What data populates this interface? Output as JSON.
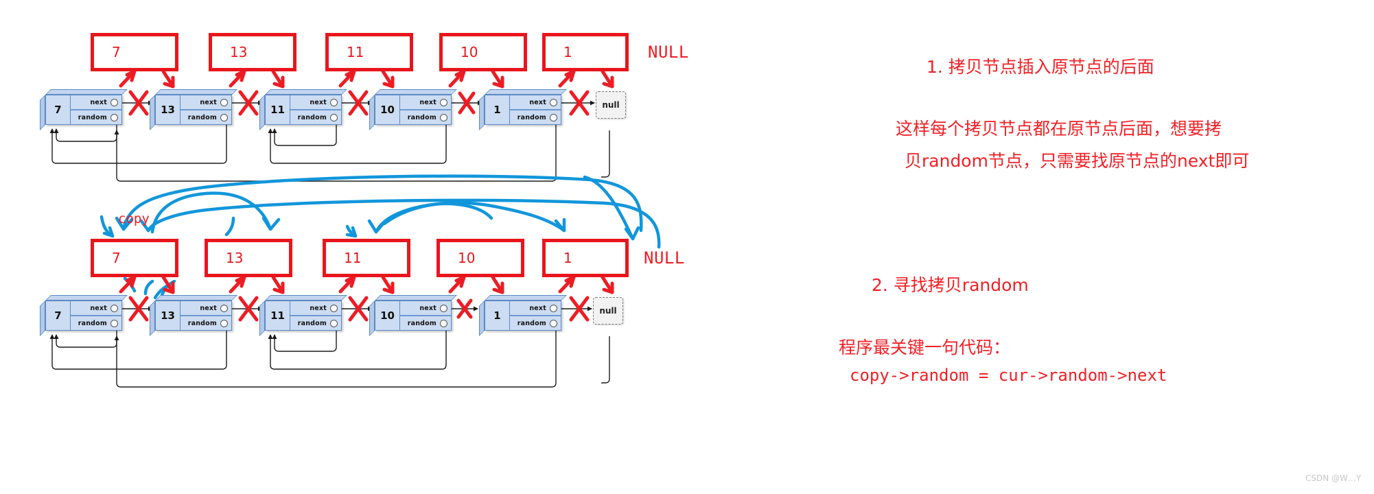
{
  "diagram": {
    "title": "Copy List with Random Pointer - interleaved copy nodes",
    "node_field_labels": {
      "next": "next",
      "random": "random"
    },
    "null_text": "null",
    "null_label": "NULL",
    "copy_label": "copy",
    "colors": {
      "red": "#f01c22",
      "box_red": "#e8161c",
      "blue_curve": "#1296db",
      "node_fill": "#ccdcf2",
      "node_border": "#5b8ac6",
      "black_arrow": "#1a1a1a"
    },
    "row1": {
      "nodes": [
        {
          "value": "7"
        },
        {
          "value": "13"
        },
        {
          "value": "11"
        },
        {
          "value": "10"
        },
        {
          "value": "1"
        }
      ],
      "copies": [
        {
          "value": "7"
        },
        {
          "value": "13"
        },
        {
          "value": "11"
        },
        {
          "value": "10"
        },
        {
          "value": "1"
        }
      ],
      "null_label": "NULL"
    },
    "row2": {
      "nodes": [
        {
          "value": "7"
        },
        {
          "value": "13"
        },
        {
          "value": "11"
        },
        {
          "value": "10"
        },
        {
          "value": "1"
        }
      ],
      "copies": [
        {
          "value": "7"
        },
        {
          "value": "13"
        },
        {
          "value": "11"
        },
        {
          "value": "10"
        },
        {
          "value": "1"
        }
      ],
      "null_label": "NULL"
    }
  },
  "notes": {
    "step1": "1. 拷贝节点插入原节点的后面",
    "explain_line1": "这样每个拷贝节点都在原节点后面，想要拷",
    "explain_line2": "贝random节点，只需要找原节点的next即可",
    "step2": "2. 寻找拷贝random",
    "key_code_title": "程序最关键一句代码：",
    "key_code": "copy->random = cur->random->next"
  },
  "watermark": "CSDN @W…Y"
}
